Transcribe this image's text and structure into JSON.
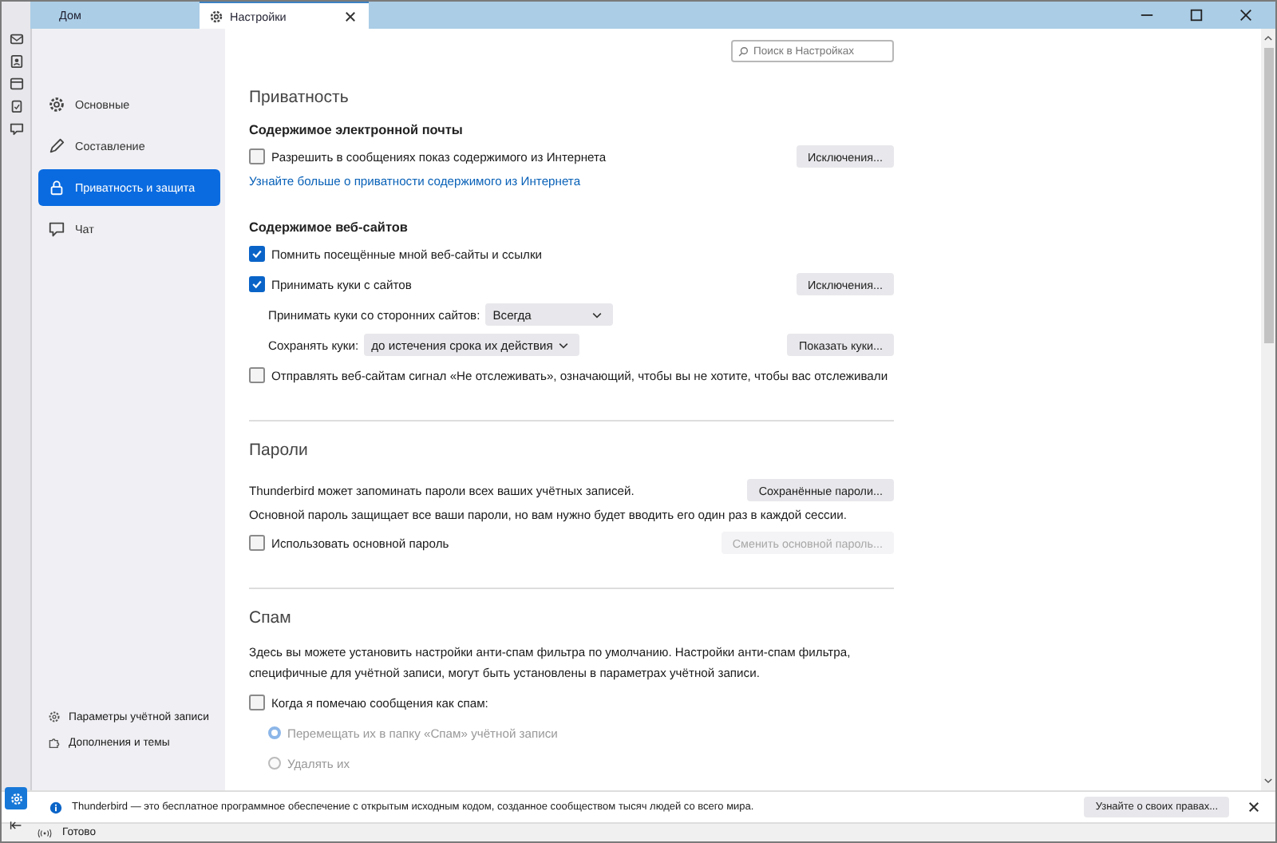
{
  "tabs": [
    {
      "label": "Дом",
      "selected": false
    },
    {
      "label": "Настройки",
      "selected": true
    }
  ],
  "search": {
    "placeholder": "Поиск в Настройках"
  },
  "sidebar": {
    "items": [
      {
        "label": "Основные",
        "selected": false
      },
      {
        "label": "Составление",
        "selected": false
      },
      {
        "label": "Приватность и защита",
        "selected": true
      },
      {
        "label": "Чат",
        "selected": false
      }
    ],
    "footer_links": [
      "Параметры учётной записи",
      "Дополнения и темы"
    ]
  },
  "privacy": {
    "title": "Приватность",
    "email": {
      "heading": "Содержимое электронной почты",
      "checkbox": {
        "label": "Разрешить в сообщениях показ содержимого из Интернета",
        "checked": false
      },
      "button": "Исключения...",
      "link": "Узнайте больше о приватности содержимого из Интернета"
    },
    "web": {
      "heading": "Содержимое веб-сайтов",
      "remember": {
        "label": "Помнить посещённые мной веб-сайты и ссылки",
        "checked": true
      },
      "cookies": {
        "label": "Принимать куки с сайтов",
        "checked": true
      },
      "exceptions_button": "Исключения...",
      "third_party": {
        "label": "Принимать куки со сторонних сайтов:",
        "value": "Всегда"
      },
      "keep": {
        "label": "Сохранять куки:",
        "value": "до истечения срока их действия"
      },
      "show_cookies_button": "Показать куки...",
      "dnt": {
        "label": "Отправлять веб-сайтам сигнал «Не отслеживать», означающий, чтобы вы не хотите, чтобы вас отслеживали",
        "checked": false
      }
    }
  },
  "passwords": {
    "title": "Пароли",
    "text": "Thunderbird может запоминать пароли всех ваших учётных записей.",
    "saved_button": "Сохранённые пароли...",
    "master_text": "Основной пароль защищает все ваши пароли, но вам нужно будет вводить его один раз в каждой сессии.",
    "master_checkbox": {
      "label": "Использовать основной пароль",
      "checked": false
    },
    "change_button": {
      "label": "Сменить основной пароль...",
      "disabled": true
    }
  },
  "spam": {
    "title": "Спам",
    "text": "Здесь вы можете установить настройки анти-спам фильтра по умолчанию. Настройки анти-спам фильтра, специфичные для учётной записи, могут быть установлены в параметрах учётной записи.",
    "checkbox": {
      "label": "Когда я помечаю сообщения как спам:",
      "checked": false
    },
    "radios": [
      {
        "label": "Перемещать их в папку «Спам» учётной записи",
        "selected": true,
        "disabled": true
      },
      {
        "label": "Удалять их",
        "selected": false,
        "disabled": true
      }
    ]
  },
  "notification": {
    "text": "Thunderbird — это бесплатное программное обеспечение с открытым исходным кодом, созданное сообществом тысяч людей со всего мира.",
    "button": "Узнайте о своих правах..."
  },
  "status_bar": {
    "text": "Готово"
  }
}
